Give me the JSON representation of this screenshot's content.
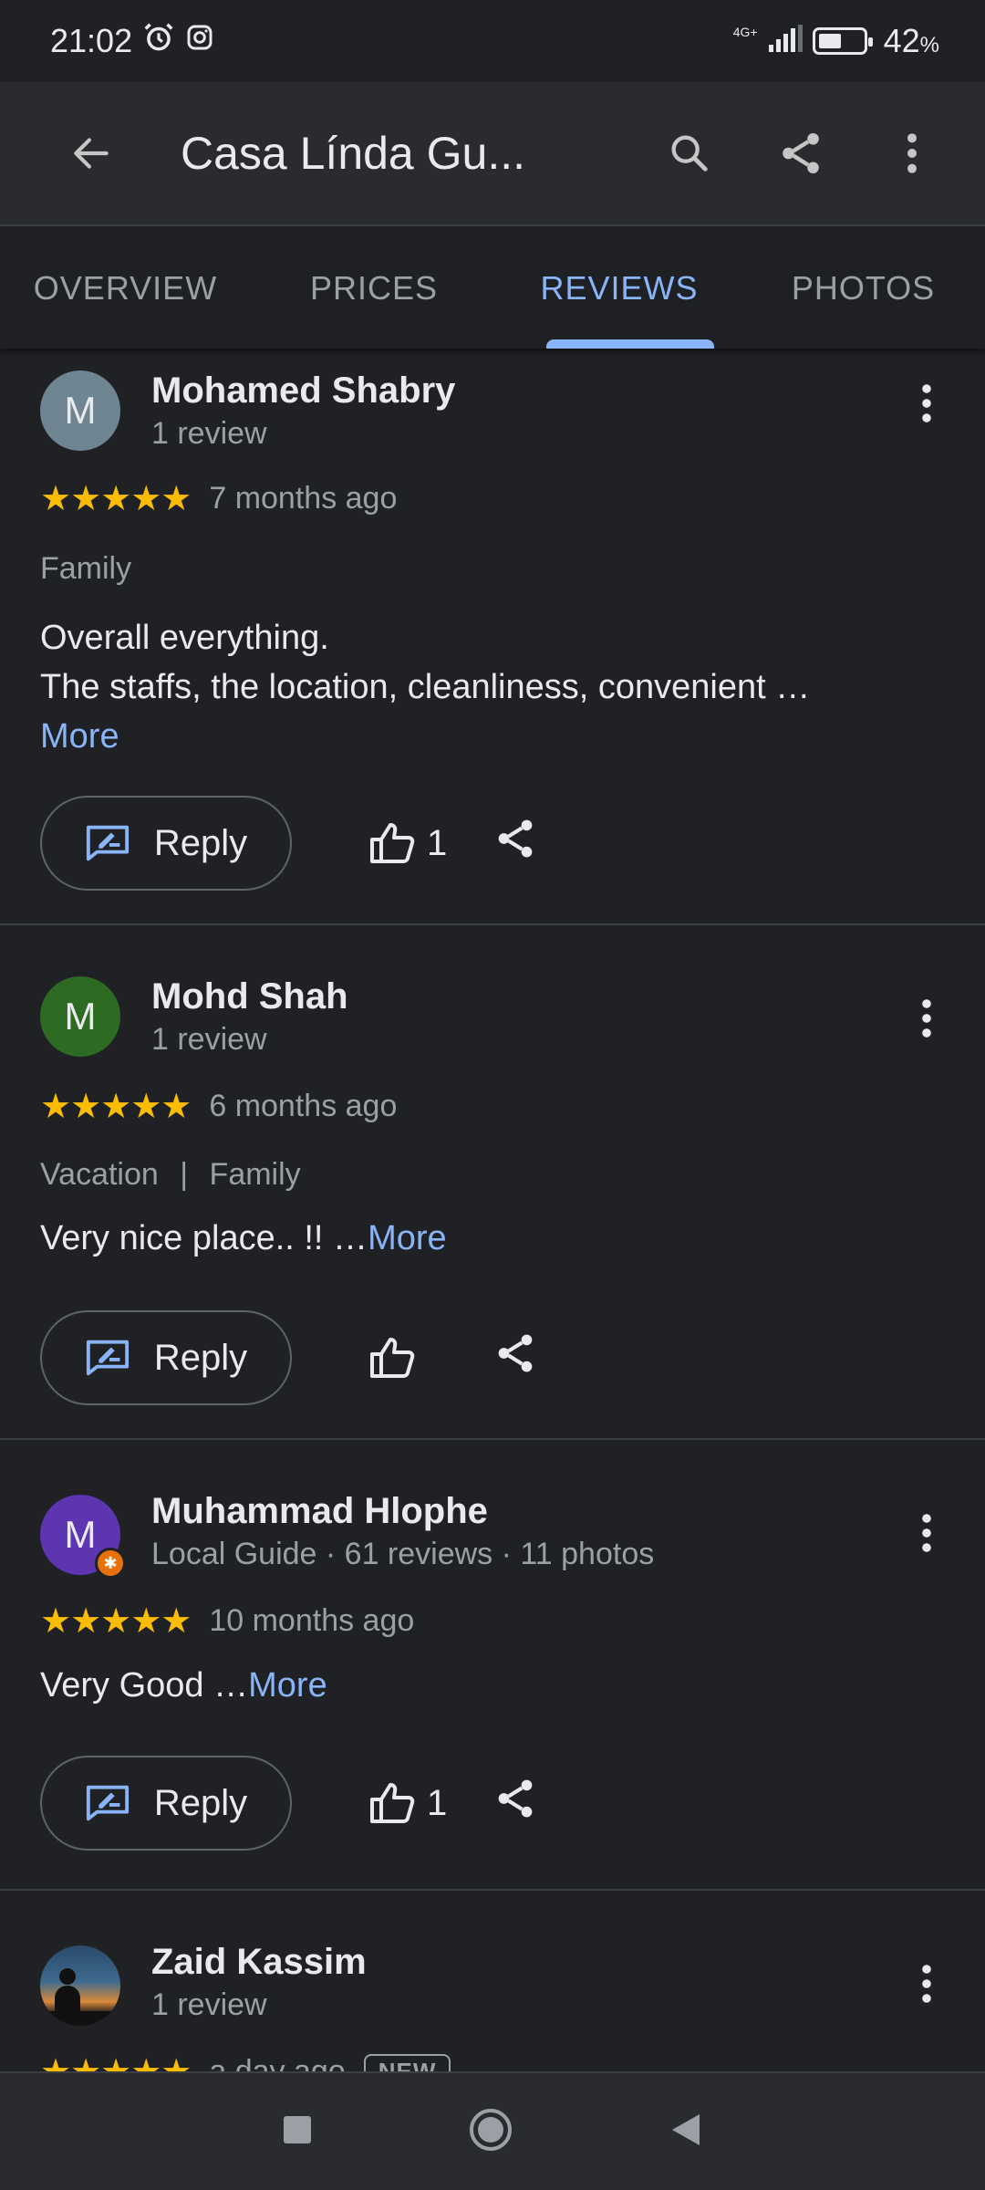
{
  "status": {
    "time": "21:02",
    "network": "4G+",
    "battery": "42",
    "battery_unit": "%"
  },
  "appbar": {
    "title": "Casa Línda Gu..."
  },
  "tabs": [
    {
      "label": "OVERVIEW",
      "active": false
    },
    {
      "label": "PRICES",
      "active": false
    },
    {
      "label": "REVIEWS",
      "active": true
    },
    {
      "label": "PHOTOS",
      "active": false
    }
  ],
  "reviews": [
    {
      "avatar_letter": "M",
      "avatar_color": "#6f8591",
      "name": "Mohamed Shabry",
      "sub": "1 review",
      "stars": "★★★★★",
      "when": "7 months ago",
      "trip_a": "Family",
      "trip_sep": "",
      "trip_b": "",
      "body_line1": "Overall everything.",
      "body_line2": "The staffs, the location, cleanliness, convenient …",
      "more": "More",
      "reply": "Reply",
      "likes": "1"
    },
    {
      "avatar_letter": "M",
      "avatar_color": "#2d6b22",
      "name": "Mohd Shah",
      "sub": "1 review",
      "stars": "★★★★★",
      "when": "6 months ago",
      "trip_a": "Vacation",
      "trip_sep": "|",
      "trip_b": "Family",
      "body": "Very nice place.. !! …",
      "more": "More",
      "reply": "Reply",
      "likes": ""
    },
    {
      "avatar_letter": "M",
      "avatar_color": "#5e35b1",
      "badge": "✱",
      "name": "Muhammad Hlophe",
      "sub": "Local Guide · 61 reviews · 11 photos",
      "stars": "★★★★★",
      "when": "10 months ago",
      "body": "Very Good …",
      "more": "More",
      "reply": "Reply",
      "likes": "1"
    },
    {
      "name": "Zaid Kassim",
      "sub": "1 review",
      "stars": "★★★★★",
      "when": "a day ago",
      "new_label": "NEW"
    }
  ]
}
